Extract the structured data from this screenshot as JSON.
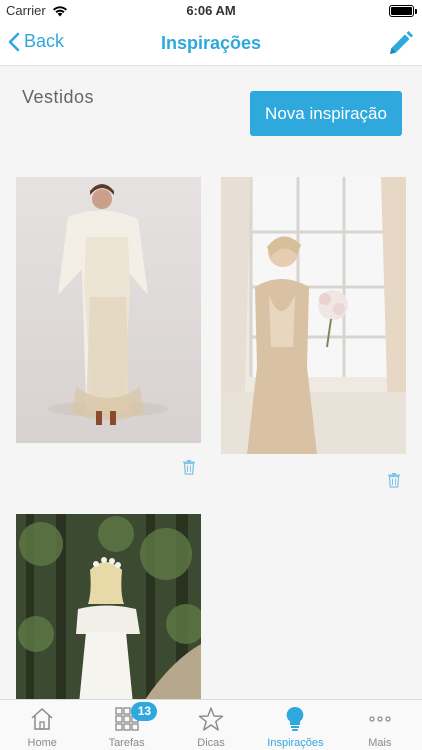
{
  "status_bar": {
    "carrier": "Carrier",
    "time": "6:06 AM"
  },
  "nav": {
    "back_label": "Back",
    "title": "Inspirações"
  },
  "section": {
    "title": "Vestidos",
    "new_button": "Nova inspiração"
  },
  "tabs": [
    {
      "label": "Home",
      "icon": "home-icon",
      "active": false
    },
    {
      "label": "Tarefas",
      "icon": "grid-icon",
      "active": false,
      "badge": "13"
    },
    {
      "label": "Dicas",
      "icon": "star-icon",
      "active": false
    },
    {
      "label": "Inspirações",
      "icon": "lightbulb-icon",
      "active": true
    },
    {
      "label": "Mais",
      "icon": "more-icon",
      "active": false
    }
  ],
  "colors": {
    "accent": "#2fa8dd",
    "background": "#f5f5f5",
    "tab_inactive": "#8a8a8a"
  }
}
